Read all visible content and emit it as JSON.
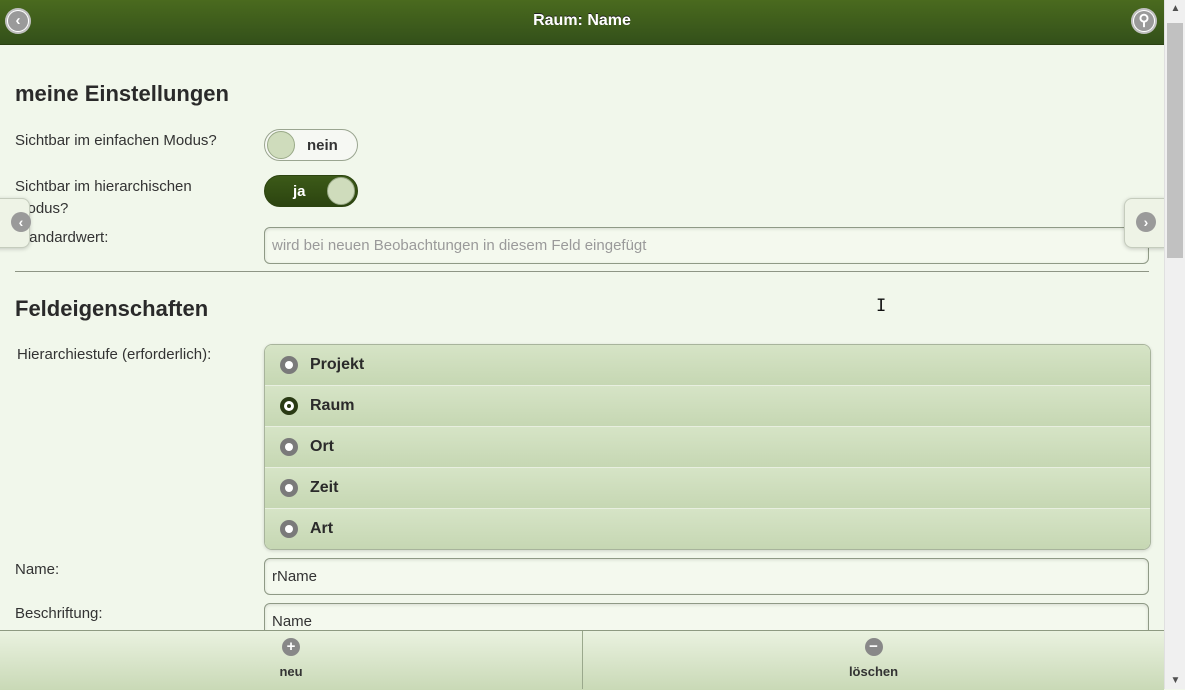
{
  "header": {
    "title": "Raum: Name",
    "back_icon": "back-arrow-icon",
    "settings_icon": "wrench-icon"
  },
  "my_settings": {
    "heading": "meine Einstellungen",
    "simple_mode_label": "Sichtbar im einfachen Modus?",
    "simple_mode_value": "nein",
    "hier_mode_label": "Sichtbar im hierarchischen Modus?",
    "hier_mode_value": "ja",
    "default_label": "Standardwert:",
    "default_placeholder": "wird bei neuen Beobachtungen in diesem Feld eingefügt"
  },
  "field_props": {
    "heading": "Feldeigenschaften",
    "level_label": "Hierarchiestufe (erforderlich):",
    "levels": [
      {
        "label": "Projekt",
        "checked": false
      },
      {
        "label": "Raum",
        "checked": true
      },
      {
        "label": "Ort",
        "checked": false
      },
      {
        "label": "Zeit",
        "checked": false
      },
      {
        "label": "Art",
        "checked": false
      }
    ],
    "name_label": "Name:",
    "name_value": "rName",
    "caption_label": "Beschriftung:",
    "caption_value": "Name"
  },
  "footer": {
    "new_label": "neu",
    "delete_label": "löschen"
  }
}
